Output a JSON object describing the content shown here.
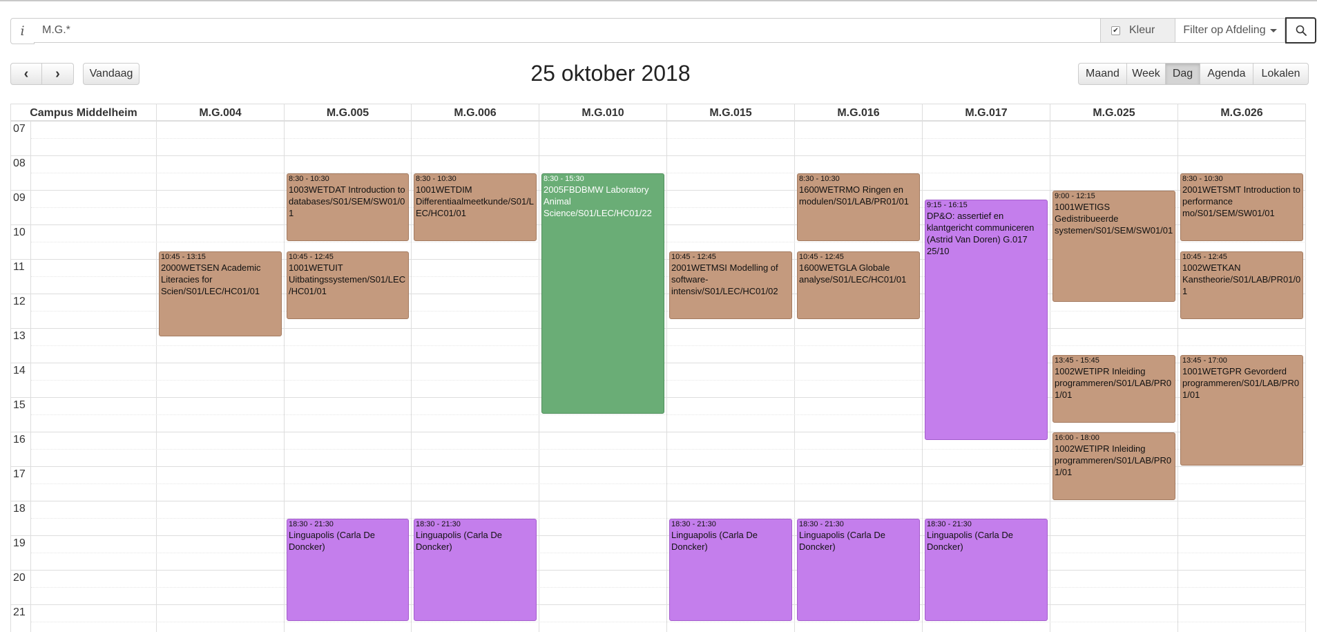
{
  "search": {
    "info_icon": "i",
    "value": "M.G.*",
    "color_toggle": {
      "label": "Kleur",
      "checked": true
    },
    "department_filter": {
      "label": "Filter op Afdeling"
    }
  },
  "toolbar": {
    "today_label": "Vandaag",
    "title": "25 oktober 2018",
    "views": [
      {
        "label": "Maand",
        "active": false
      },
      {
        "label": "Week",
        "active": false
      },
      {
        "label": "Dag",
        "active": true
      },
      {
        "label": "Agenda",
        "active": false
      },
      {
        "label": "Lokalen",
        "active": false
      }
    ]
  },
  "calendar": {
    "hours": [
      "07",
      "08",
      "09",
      "10",
      "11",
      "12",
      "13",
      "14",
      "15",
      "16",
      "17",
      "18",
      "19",
      "20",
      "21"
    ],
    "columns": [
      "Campus Middelheim",
      "M.G.004",
      "M.G.005",
      "M.G.006",
      "M.G.010",
      "M.G.015",
      "M.G.016",
      "M.G.017",
      "M.G.025",
      "M.G.026"
    ],
    "colors": {
      "tan": "#c49a7e",
      "purple": "#c47eec",
      "green": "#6aad76"
    },
    "events": [
      {
        "col": 1,
        "start": "10:45",
        "end": "13:15",
        "time": "10:45 - 13:15",
        "title": "2000WETSEN Academic Literacies for Scien/S01/LEC/HC01/01",
        "color": "tan"
      },
      {
        "col": 2,
        "start": "8:30",
        "end": "10:30",
        "time": "8:30 - 10:30",
        "title": "1003WETDAT Introduction to databases/S01/SEM/SW01/01",
        "color": "tan"
      },
      {
        "col": 2,
        "start": "10:45",
        "end": "12:45",
        "time": "10:45 - 12:45",
        "title": "1001WETUIT Uitbatingssystemen/S01/LEC/HC01/01",
        "color": "tan"
      },
      {
        "col": 2,
        "start": "18:30",
        "end": "21:30",
        "time": "18:30 - 21:30",
        "title": "Linguapolis (Carla De Doncker)",
        "color": "purple"
      },
      {
        "col": 3,
        "start": "8:30",
        "end": "10:30",
        "time": "8:30 - 10:30",
        "title": "1001WETDIM Differentiaalmeetkunde/S01/LEC/HC01/01",
        "color": "tan"
      },
      {
        "col": 3,
        "start": "18:30",
        "end": "21:30",
        "time": "18:30 - 21:30",
        "title": "Linguapolis (Carla De Doncker)",
        "color": "purple"
      },
      {
        "col": 4,
        "start": "8:30",
        "end": "15:30",
        "time": "8:30 - 15:30",
        "title": "2005FBDBMW Laboratory Animal Science/S01/LEC/HC01/22",
        "color": "green"
      },
      {
        "col": 5,
        "start": "10:45",
        "end": "12:45",
        "time": "10:45 - 12:45",
        "title": "2001WETMSI Modelling of software-intensiv/S01/LEC/HC01/02",
        "color": "tan"
      },
      {
        "col": 5,
        "start": "18:30",
        "end": "21:30",
        "time": "18:30 - 21:30",
        "title": "Linguapolis (Carla De Doncker)",
        "color": "purple"
      },
      {
        "col": 6,
        "start": "8:30",
        "end": "10:30",
        "time": "8:30 - 10:30",
        "title": "1600WETRMO Ringen en modulen/S01/LAB/PR01/01",
        "color": "tan"
      },
      {
        "col": 6,
        "start": "10:45",
        "end": "12:45",
        "time": "10:45 - 12:45",
        "title": "1600WETGLA Globale analyse/S01/LEC/HC01/01",
        "color": "tan"
      },
      {
        "col": 6,
        "start": "18:30",
        "end": "21:30",
        "time": "18:30 - 21:30",
        "title": "Linguapolis (Carla De Doncker)",
        "color": "purple"
      },
      {
        "col": 7,
        "start": "9:15",
        "end": "16:15",
        "time": "9:15 - 16:15",
        "title": "DP&O: assertief en klantgericht communiceren (Astrid Van Doren) G.017 25/10",
        "color": "purple"
      },
      {
        "col": 7,
        "start": "18:30",
        "end": "21:30",
        "time": "18:30 - 21:30",
        "title": "Linguapolis (Carla De Doncker)",
        "color": "purple"
      },
      {
        "col": 8,
        "start": "9:00",
        "end": "12:15",
        "time": "9:00 - 12:15",
        "title": "1001WETIGS Gedistribueerde systemen/S01/SEM/SW01/01",
        "color": "tan"
      },
      {
        "col": 8,
        "start": "13:45",
        "end": "15:45",
        "time": "13:45 - 15:45",
        "title": "1002WETIPR Inleiding programmeren/S01/LAB/PR01/01",
        "color": "tan"
      },
      {
        "col": 8,
        "start": "16:00",
        "end": "18:00",
        "time": "16:00 - 18:00",
        "title": "1002WETIPR Inleiding programmeren/S01/LAB/PR01/01",
        "color": "tan"
      },
      {
        "col": 9,
        "start": "8:30",
        "end": "10:30",
        "time": "8:30 - 10:30",
        "title": "2001WETSMT Introduction to performance mo/S01/SEM/SW01/01",
        "color": "tan"
      },
      {
        "col": 9,
        "start": "10:45",
        "end": "12:45",
        "time": "10:45 - 12:45",
        "title": "1002WETKAN Kanstheorie/S01/LAB/PR01/01",
        "color": "tan"
      },
      {
        "col": 9,
        "start": "13:45",
        "end": "17:00",
        "time": "13:45 - 17:00",
        "title": "1001WETGPR Gevorderd programmeren/S01/LAB/PR01/01",
        "color": "tan"
      }
    ]
  }
}
